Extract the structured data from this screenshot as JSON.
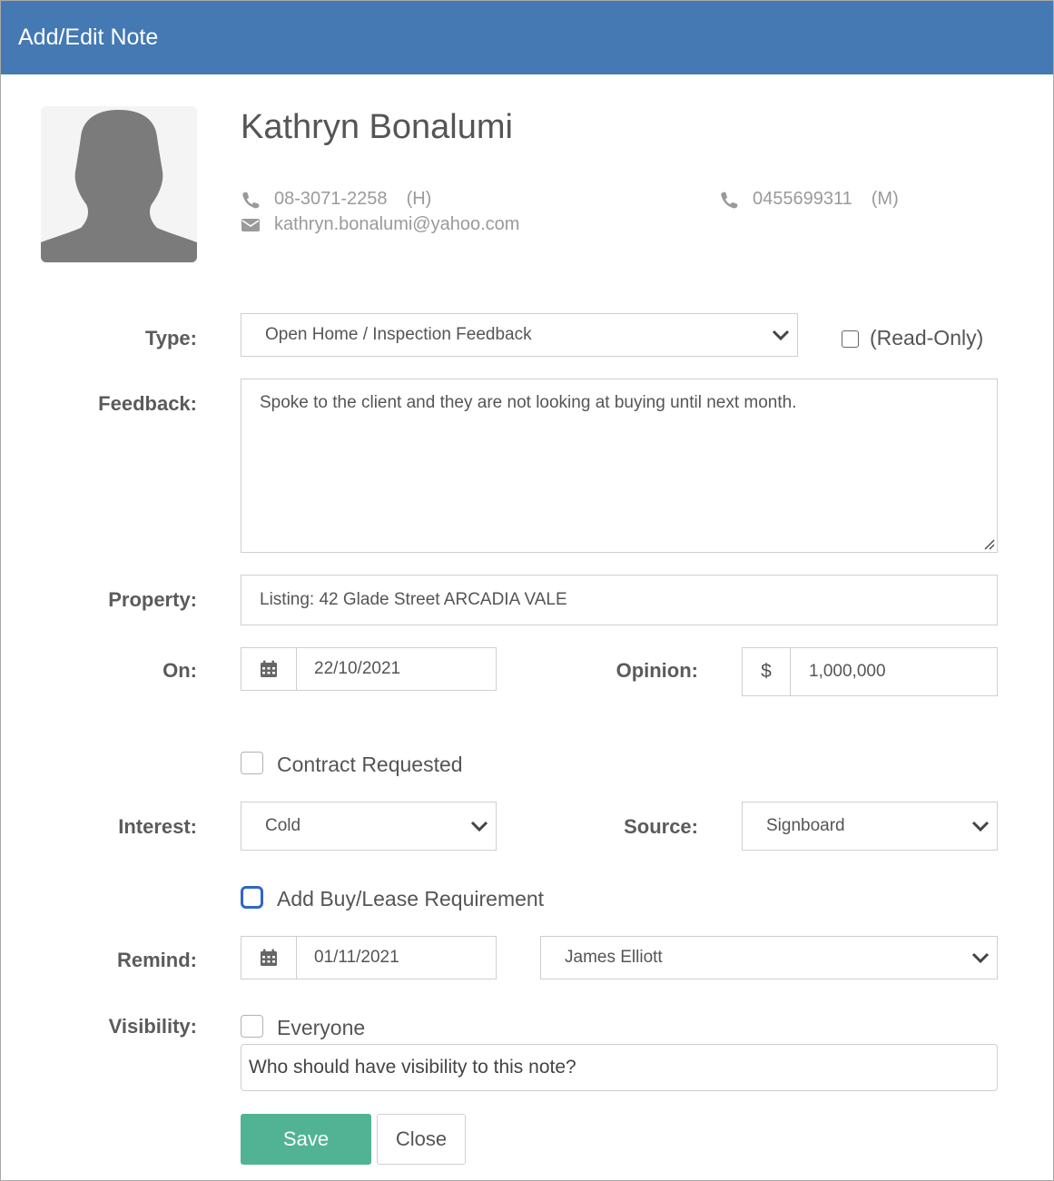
{
  "dialog": {
    "title": "Add/Edit Note"
  },
  "contact": {
    "name": "Kathryn Bonalumi",
    "home_phone": "08-3071-2258",
    "home_tag": "(H)",
    "mobile_phone": "0455699311",
    "mobile_tag": "(M)",
    "email": "kathryn.bonalumi@yahoo.com"
  },
  "form": {
    "type": {
      "label": "Type:",
      "value": "Open Home / Inspection Feedback",
      "read_only_label": "(Read-Only)",
      "read_only_checked": false
    },
    "feedback": {
      "label": "Feedback:",
      "value": "Spoke to the client and they are not looking at buying until next month."
    },
    "property": {
      "label": "Property:",
      "value": "Listing: 42 Glade Street ARCADIA VALE"
    },
    "on": {
      "label": "On:",
      "value": "22/10/2021"
    },
    "opinion": {
      "label": "Opinion:",
      "prefix": "$",
      "value": "1,000,000"
    },
    "contract_requested": {
      "label": "Contract Requested",
      "checked": false
    },
    "interest": {
      "label": "Interest:",
      "value": "Cold"
    },
    "source": {
      "label": "Source:",
      "value": "Signboard"
    },
    "add_requirement": {
      "label": "Add Buy/Lease Requirement",
      "checked": false
    },
    "remind": {
      "label": "Remind:",
      "date": "01/11/2021",
      "assignee": "James Elliott"
    },
    "visibility": {
      "label": "Visibility:",
      "everyone_label": "Everyone",
      "everyone_checked": false,
      "placeholder": "Who should have visibility to this note?"
    }
  },
  "buttons": {
    "save": "Save",
    "close": "Close"
  },
  "colors": {
    "header": "#4479b3",
    "save": "#52b394",
    "focus": "#2f67c7"
  },
  "icons": [
    "avatar-silhouette-icon",
    "phone-icon",
    "envelope-icon",
    "calendar-icon",
    "chevron-down-icon"
  ]
}
